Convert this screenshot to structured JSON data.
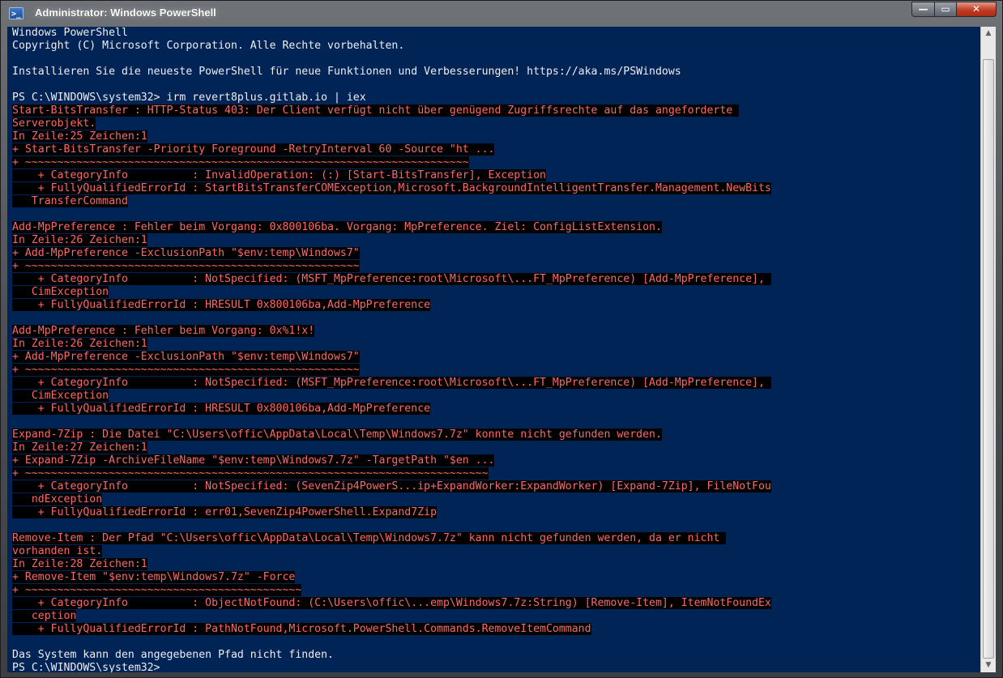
{
  "window": {
    "title": "Administrator: Windows PowerShell",
    "icon": "powershell-icon",
    "controls": {
      "minimize": "—",
      "maximize": "▭",
      "close": "✕"
    }
  },
  "colors": {
    "console_bg": "#012456",
    "text": "#eeedf0",
    "error_text": "#f86a6a",
    "error_bg": "#000000"
  },
  "console": {
    "lines": [
      {
        "text": "Windows PowerShell",
        "type": "normal"
      },
      {
        "text": "Copyright (C) Microsoft Corporation. Alle Rechte vorbehalten.",
        "type": "normal"
      },
      {
        "text": "",
        "type": "normal"
      },
      {
        "text": "Installieren Sie die neueste PowerShell für neue Funktionen und Verbesserungen! https://aka.ms/PSWindows",
        "type": "normal"
      },
      {
        "text": "",
        "type": "normal"
      },
      {
        "text": "PS C:\\WINDOWS\\system32> irm revert8plus.gitlab.io | iex",
        "type": "normal"
      },
      {
        "text": "Start-BitsTransfer : HTTP-Status 403: Der Client verfügt nicht über genügend Zugriffsrechte auf das angeforderte ",
        "type": "error"
      },
      {
        "text": "Serverobjekt.",
        "type": "error"
      },
      {
        "text": "In Zeile:25 Zeichen:1",
        "type": "error"
      },
      {
        "text": "+ Start-BitsTransfer -Priority Foreground -RetryInterval 60 -Source \"ht ...",
        "type": "error"
      },
      {
        "text": "+ ~~~~~~~~~~~~~~~~~~~~~~~~~~~~~~~~~~~~~~~~~~~~~~~~~~~~~~~~~~~~~~~~~~~~~",
        "type": "error"
      },
      {
        "text": "    + CategoryInfo          : InvalidOperation: (:) [Start-BitsTransfer], Exception",
        "type": "error"
      },
      {
        "text": "    + FullyQualifiedErrorId : StartBitsTransferCOMException,Microsoft.BackgroundIntelligentTransfer.Management.NewBits",
        "type": "error"
      },
      {
        "text": "   TransferCommand",
        "type": "error"
      },
      {
        "text": "",
        "type": "error"
      },
      {
        "text": "Add-MpPreference : Fehler beim Vorgang: 0x800106ba. Vorgang: MpPreference. Ziel: ConfigListExtension.",
        "type": "error"
      },
      {
        "text": "In Zeile:26 Zeichen:1",
        "type": "error"
      },
      {
        "text": "+ Add-MpPreference -ExclusionPath \"$env:temp\\Windows7\"",
        "type": "error"
      },
      {
        "text": "+ ~~~~~~~~~~~~~~~~~~~~~~~~~~~~~~~~~~~~~~~~~~~~~~~~~~~~",
        "type": "error"
      },
      {
        "text": "    + CategoryInfo          : NotSpecified: (MSFT_MpPreference:root\\Microsoft\\...FT_MpPreference) [Add-MpPreference], ",
        "type": "error"
      },
      {
        "text": "   CimException",
        "type": "error"
      },
      {
        "text": "    + FullyQualifiedErrorId : HRESULT 0x800106ba,Add-MpPreference",
        "type": "error"
      },
      {
        "text": "",
        "type": "error"
      },
      {
        "text": "Add-MpPreference : Fehler beim Vorgang: 0x%1!x!",
        "type": "error"
      },
      {
        "text": "In Zeile:26 Zeichen:1",
        "type": "error"
      },
      {
        "text": "+ Add-MpPreference -ExclusionPath \"$env:temp\\Windows7\"",
        "type": "error"
      },
      {
        "text": "+ ~~~~~~~~~~~~~~~~~~~~~~~~~~~~~~~~~~~~~~~~~~~~~~~~~~~~",
        "type": "error"
      },
      {
        "text": "    + CategoryInfo          : NotSpecified: (MSFT_MpPreference:root\\Microsoft\\...FT_MpPreference) [Add-MpPreference], ",
        "type": "error"
      },
      {
        "text": "   CimException",
        "type": "error"
      },
      {
        "text": "    + FullyQualifiedErrorId : HRESULT 0x800106ba,Add-MpPreference",
        "type": "error"
      },
      {
        "text": "",
        "type": "error"
      },
      {
        "text": "Expand-7Zip : Die Datei \"C:\\Users\\offic\\AppData\\Local\\Temp\\Windows7.7z\" konnte nicht gefunden werden.",
        "type": "error"
      },
      {
        "text": "In Zeile:27 Zeichen:1",
        "type": "error"
      },
      {
        "text": "+ Expand-7Zip -ArchiveFileName \"$env:temp\\Windows7.7z\" -TargetPath \"$en ...",
        "type": "error"
      },
      {
        "text": "+ ~~~~~~~~~~~~~~~~~~~~~~~~~~~~~~~~~~~~~~~~~~~~~~~~~~~~~~~~~~~~~~~~~~~~~~~~",
        "type": "error"
      },
      {
        "text": "    + CategoryInfo          : NotSpecified: (SevenZip4PowerS...ip+ExpandWorker:ExpandWorker) [Expand-7Zip], FileNotFou",
        "type": "error"
      },
      {
        "text": "   ndException",
        "type": "error"
      },
      {
        "text": "    + FullyQualifiedErrorId : err01,SevenZip4PowerShell.Expand7Zip",
        "type": "error"
      },
      {
        "text": "",
        "type": "error"
      },
      {
        "text": "Remove-Item : Der Pfad \"C:\\Users\\offic\\AppData\\Local\\Temp\\Windows7.7z\" kann nicht gefunden werden, da er nicht ",
        "type": "error"
      },
      {
        "text": "vorhanden ist.",
        "type": "error"
      },
      {
        "text": "In Zeile:28 Zeichen:1",
        "type": "error"
      },
      {
        "text": "+ Remove-Item \"$env:temp\\Windows7.7z\" -Force",
        "type": "error"
      },
      {
        "text": "+ ~~~~~~~~~~~~~~~~~~~~~~~~~~~~~~~~~~~~~~~~~~~",
        "type": "error"
      },
      {
        "text": "    + CategoryInfo          : ObjectNotFound: (C:\\Users\\offic\\...emp\\Windows7.7z:String) [Remove-Item], ItemNotFoundEx",
        "type": "error"
      },
      {
        "text": "   ception",
        "type": "error"
      },
      {
        "text": "    + FullyQualifiedErrorId : PathNotFound,Microsoft.PowerShell.Commands.RemoveItemCommand",
        "type": "error"
      },
      {
        "text": "",
        "type": "error"
      },
      {
        "text": "Das System kann den angegebenen Pfad nicht finden.",
        "type": "normal"
      },
      {
        "text": "PS C:\\WINDOWS\\system32>",
        "type": "normal"
      }
    ]
  }
}
